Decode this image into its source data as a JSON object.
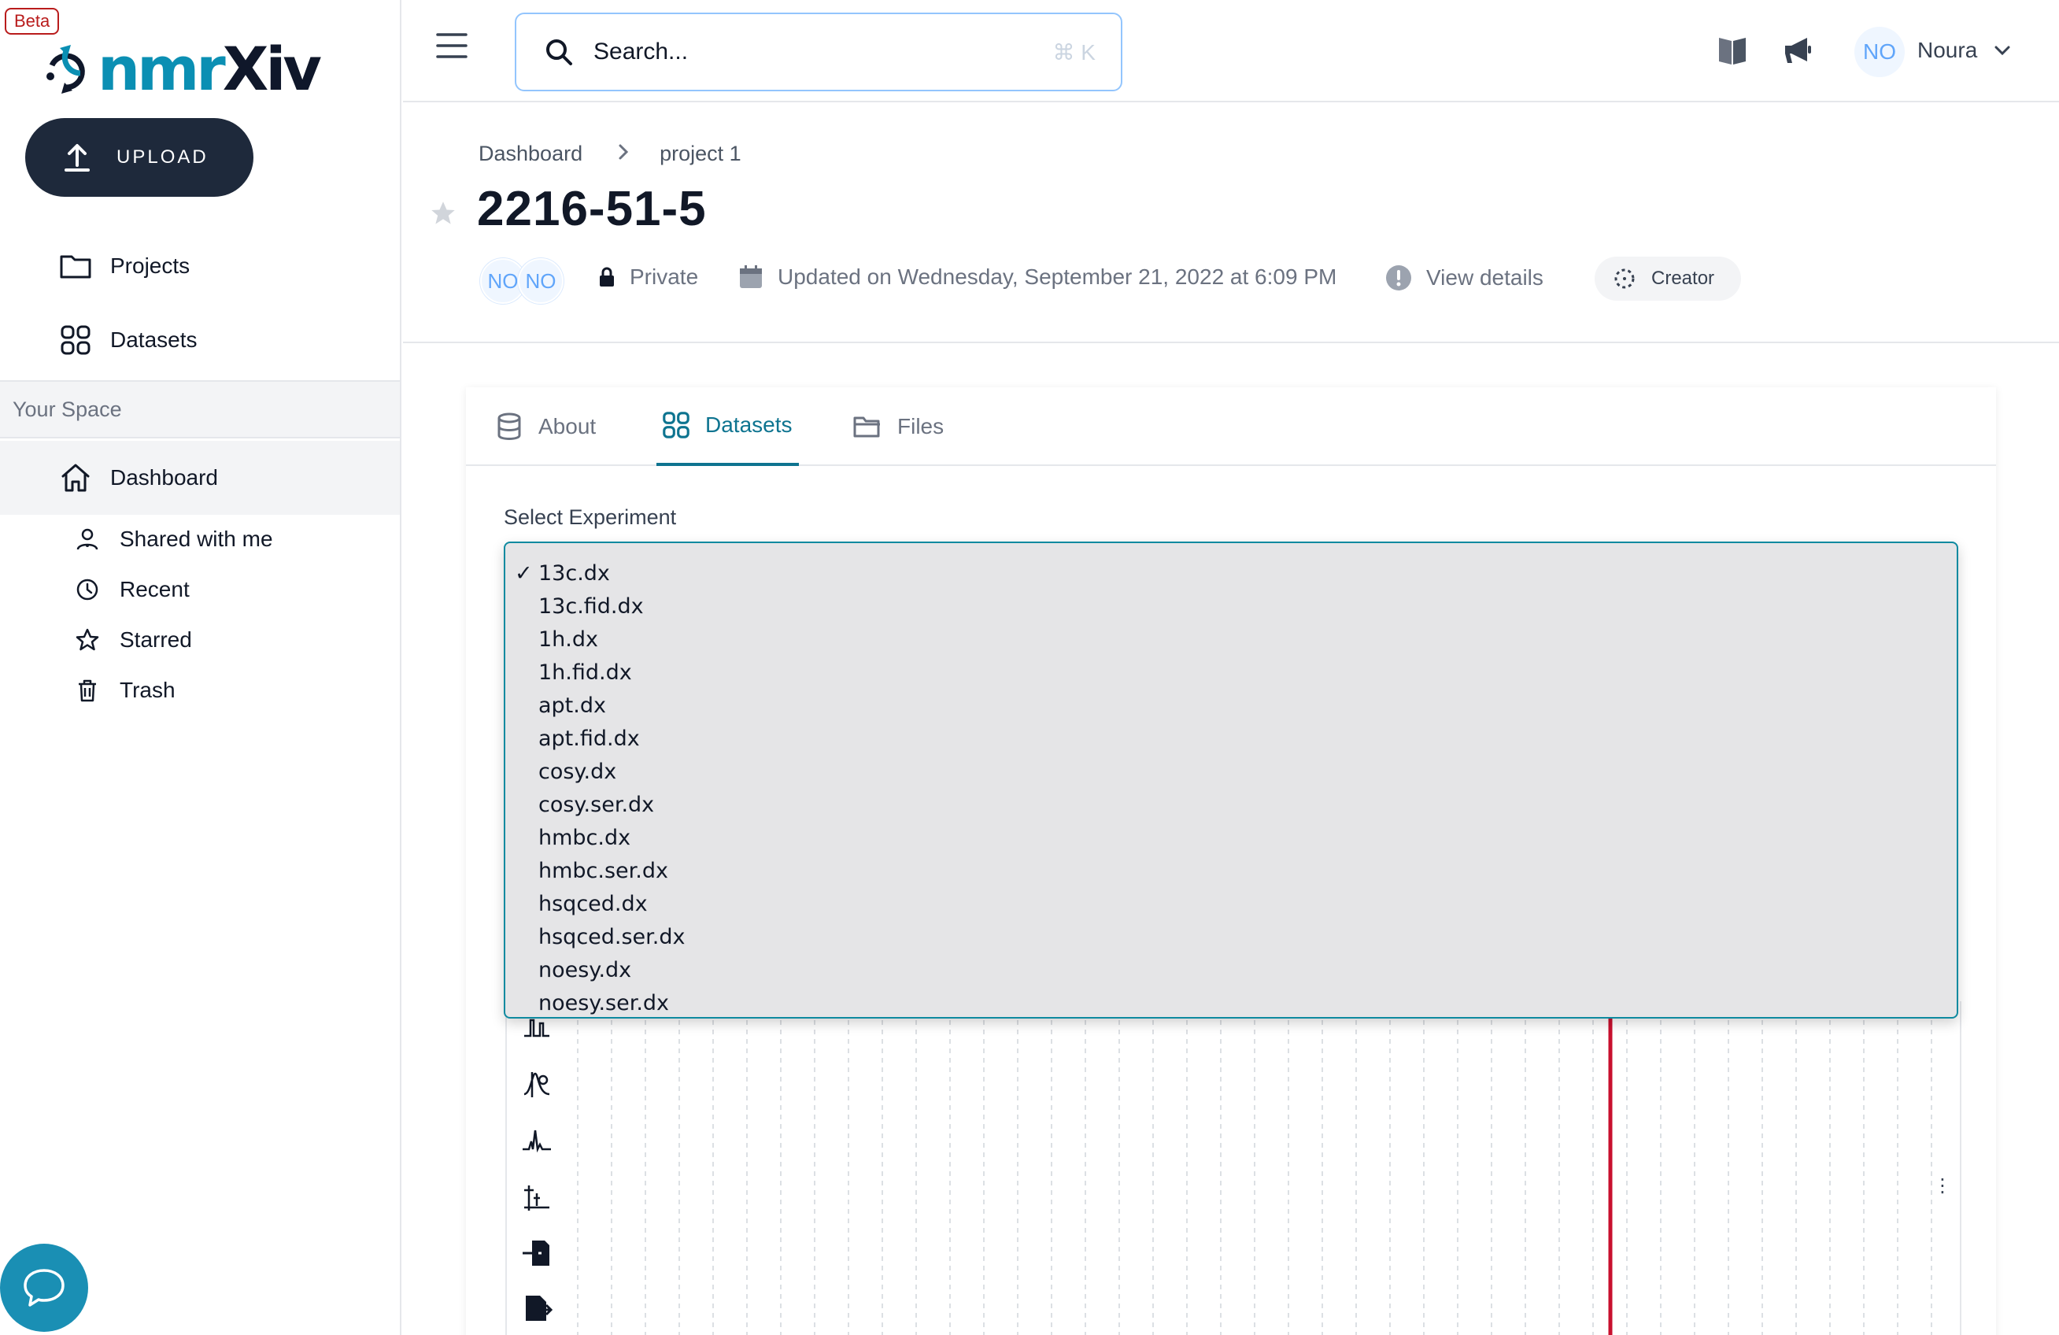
{
  "app": {
    "beta_label": "Beta",
    "logo_part1": "nmr",
    "logo_part2": "Xiv",
    "accent_color": "#0e7490"
  },
  "sidebar": {
    "upload_label": "UPLOAD",
    "items": [
      {
        "label": "Projects",
        "icon": "folder-icon"
      },
      {
        "label": "Datasets",
        "icon": "grid-icon"
      }
    ],
    "space_header": "Your Space",
    "dashboard_label": "Dashboard",
    "sub_items": [
      {
        "label": "Shared with me",
        "icon": "users-icon"
      },
      {
        "label": "Recent",
        "icon": "clock-icon"
      },
      {
        "label": "Starred",
        "icon": "star-icon"
      },
      {
        "label": "Trash",
        "icon": "trash-icon"
      }
    ]
  },
  "topbar": {
    "search_placeholder": "Search...",
    "search_shortcut": "⌘ K",
    "user_initials": "NO",
    "user_name": "Noura"
  },
  "project": {
    "breadcrumb": [
      "Dashboard",
      "project 1"
    ],
    "title": "2216-51-5",
    "collaborators": [
      "NO",
      "NO"
    ],
    "visibility": "Private",
    "updated": "Updated on Wednesday, September 21, 2022 at 6:09 PM",
    "details_link": "View details",
    "role": "Creator"
  },
  "tabs": [
    {
      "label": "About",
      "icon": "database-icon"
    },
    {
      "label": "Datasets",
      "icon": "grid-icon",
      "active": true
    },
    {
      "label": "Files",
      "icon": "folder-open-icon"
    }
  ],
  "experiment": {
    "label": "Select Experiment",
    "selected": "13c.dx",
    "options": [
      "13c.dx",
      "13c.fid.dx",
      "1h.dx",
      "1h.fid.dx",
      "apt.dx",
      "apt.fid.dx",
      "cosy.dx",
      "cosy.ser.dx",
      "hmbc.dx",
      "hmbc.ser.dx",
      "hsqced.dx",
      "hsqced.ser.dx",
      "noesy.dx",
      "noesy.ser.dx"
    ]
  },
  "viewer": {
    "more_label": "⋮",
    "peak_color": "#c8102e"
  }
}
